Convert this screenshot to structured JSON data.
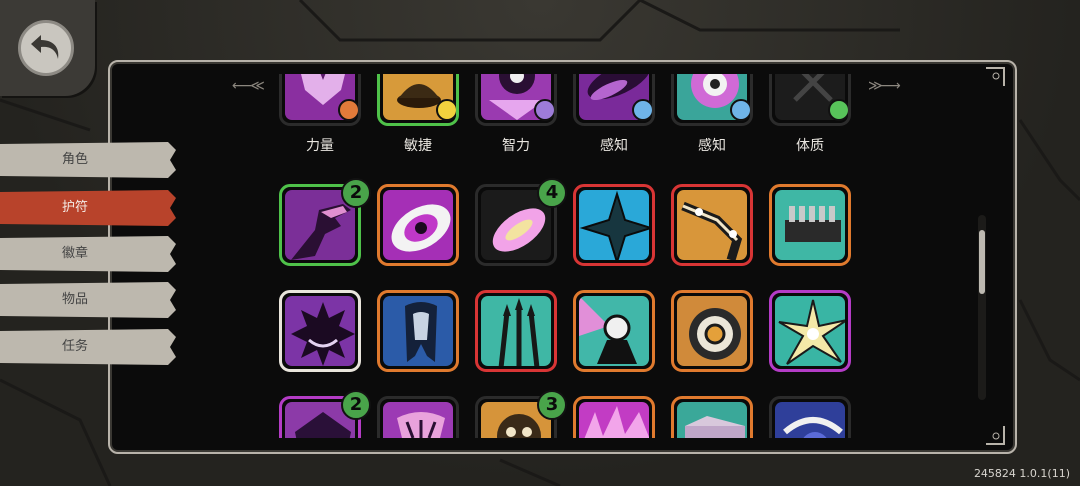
{
  "sidebar": {
    "tabs": [
      {
        "label": "角色",
        "active": false
      },
      {
        "label": "护符",
        "active": true
      },
      {
        "label": "徽章",
        "active": false
      },
      {
        "label": "物品",
        "active": false
      },
      {
        "label": "任务",
        "active": false
      }
    ]
  },
  "stats": {
    "labels": [
      "力量",
      "敏捷",
      "智力",
      "感知",
      "感知",
      "体质"
    ]
  },
  "charm_grid": {
    "row1_badges": {
      "first": "2",
      "third": "4"
    },
    "row3_badges": {
      "first": "2",
      "third": "3"
    }
  },
  "footer": {
    "version": "245824 1.0.1(11)"
  },
  "colors": {
    "active_tab": "#b8432b",
    "inactive_tab": "#bdb8ae",
    "badge": "#49a44a"
  }
}
